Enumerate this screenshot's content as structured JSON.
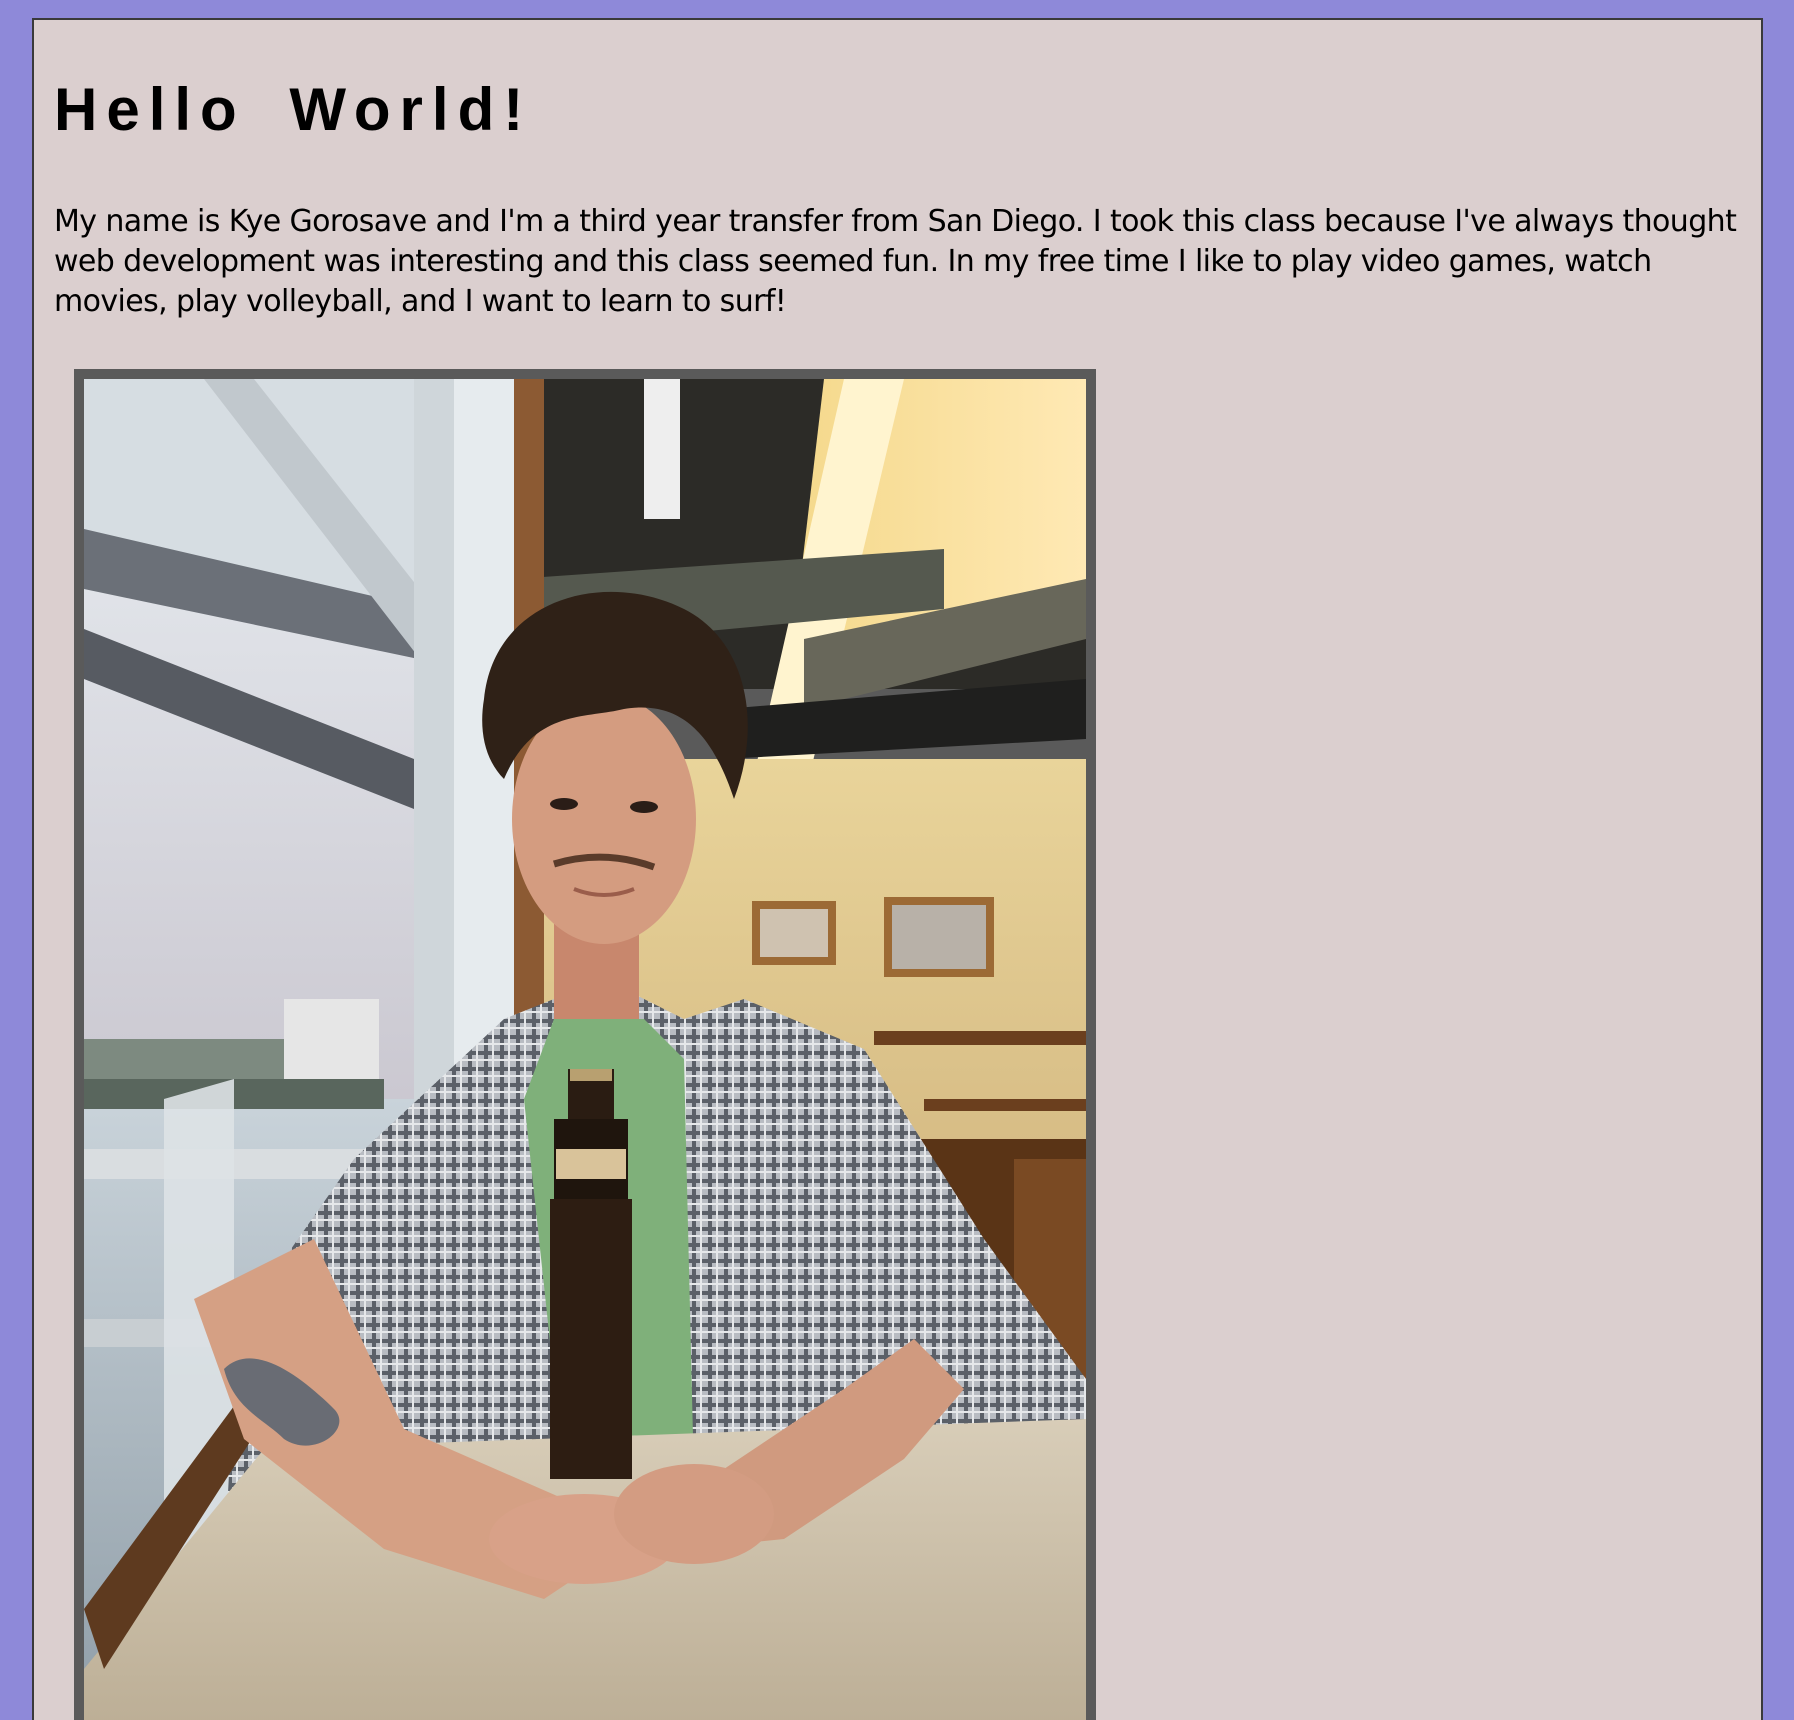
{
  "page": {
    "heading": "Hello World!",
    "intro": "My name is Kye Gorosave and I'm a third year transfer from San Diego. I took this class because I've always thought web development was interesting and this class seemed fun. In my free time I like to play video games, watch movies, play volleyball, and I want to learn to surf!"
  },
  "colors": {
    "page_background": "#8e89d9",
    "card_background": "#dbcfcf",
    "frame": "#5a5a5a"
  },
  "photo": {
    "icon": "portrait-photo"
  }
}
